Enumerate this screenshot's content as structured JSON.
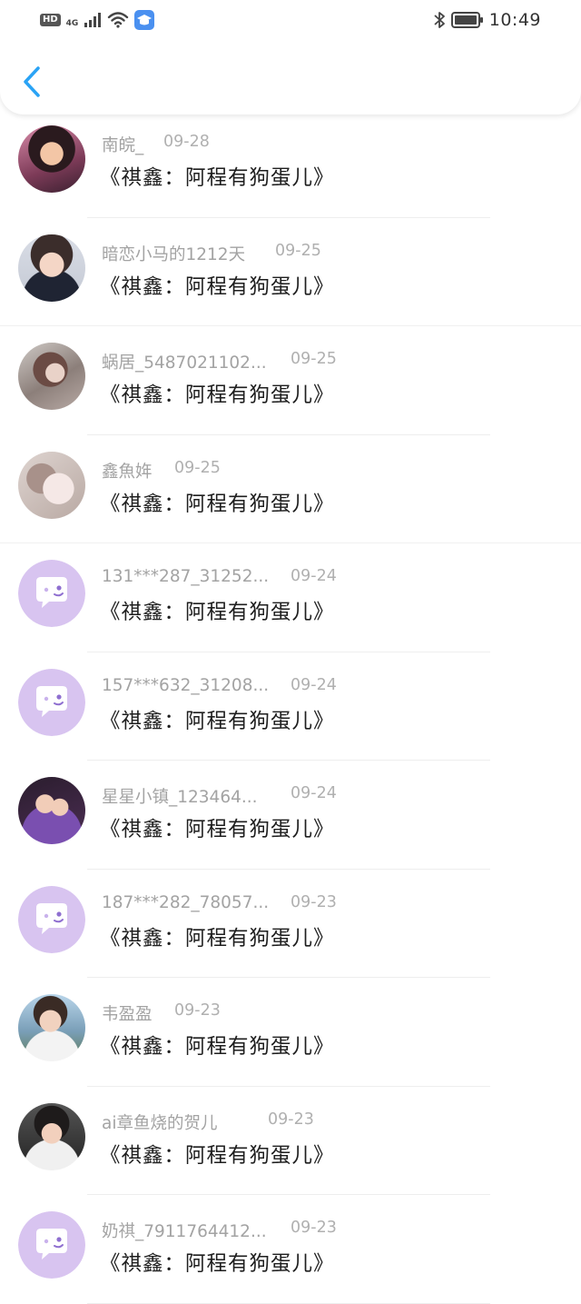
{
  "status_bar": {
    "hd_label": "HD",
    "network_label": "4G",
    "time": "10:49"
  },
  "icons": {
    "back": "chevron-left-icon",
    "app_notification": "graduation-cap-icon",
    "default_avatar": "chat-bubble-icon"
  },
  "colors": {
    "accent": "#2aa3f5",
    "default_avatar_bg": "#d8c4f0"
  },
  "list": {
    "items": [
      {
        "name": "南皖_",
        "date": "09-28",
        "title": "《祺鑫：阿程有狗蛋儿》"
      },
      {
        "name": "暗恋小马的1212天",
        "date": "09-25",
        "title": "《祺鑫：阿程有狗蛋儿》"
      },
      {
        "name": "蜗居_5487021102...",
        "date": "09-25",
        "title": "《祺鑫：阿程有狗蛋儿》"
      },
      {
        "name": "鑫魚姩",
        "date": "09-25",
        "title": "《祺鑫：阿程有狗蛋儿》"
      },
      {
        "name": "131***287_31252...",
        "date": "09-24",
        "title": "《祺鑫：阿程有狗蛋儿》"
      },
      {
        "name": "157***632_31208...",
        "date": "09-24",
        "title": "《祺鑫：阿程有狗蛋儿》"
      },
      {
        "name": "星星小镇_123464...",
        "date": "09-24",
        "title": "《祺鑫：阿程有狗蛋儿》"
      },
      {
        "name": "187***282_78057...",
        "date": "09-23",
        "title": "《祺鑫：阿程有狗蛋儿》"
      },
      {
        "name": "韦盈盈",
        "date": "09-23",
        "title": "《祺鑫：阿程有狗蛋儿》"
      },
      {
        "name": "ai章鱼烧的贺儿",
        "date": "09-23",
        "title": "《祺鑫：阿程有狗蛋儿》"
      },
      {
        "name": "奶祺_7911764412...",
        "date": "09-23",
        "title": "《祺鑫：阿程有狗蛋儿》"
      }
    ]
  }
}
